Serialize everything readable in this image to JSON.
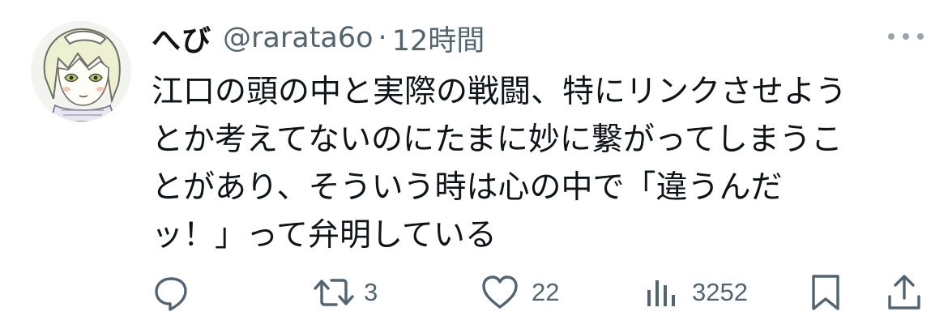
{
  "user": {
    "display_name": "へび",
    "handle": "@rarata6o",
    "separator": "·",
    "time": "12時間"
  },
  "tweet": {
    "lines": [
      "江口の頭の中と実際の戦闘、特にリンクさせよう",
      "とか考えてないのにたまに妙に繋がってしまうこ",
      "とがあり、そういう時は心の中で「違うんだ",
      "ッ！」って弁明している"
    ]
  },
  "actions": {
    "reply": {
      "icon": "reply-icon"
    },
    "retweet": {
      "icon": "retweet-icon",
      "count": "3"
    },
    "like": {
      "icon": "heart-icon",
      "count": "22"
    },
    "views": {
      "icon": "views-icon",
      "count": "3252"
    },
    "bookmark": {
      "icon": "bookmark-icon"
    },
    "share": {
      "icon": "share-icon"
    }
  },
  "colors": {
    "text": "#0f1419",
    "secondary": "#536471",
    "background": "#ffffff"
  }
}
